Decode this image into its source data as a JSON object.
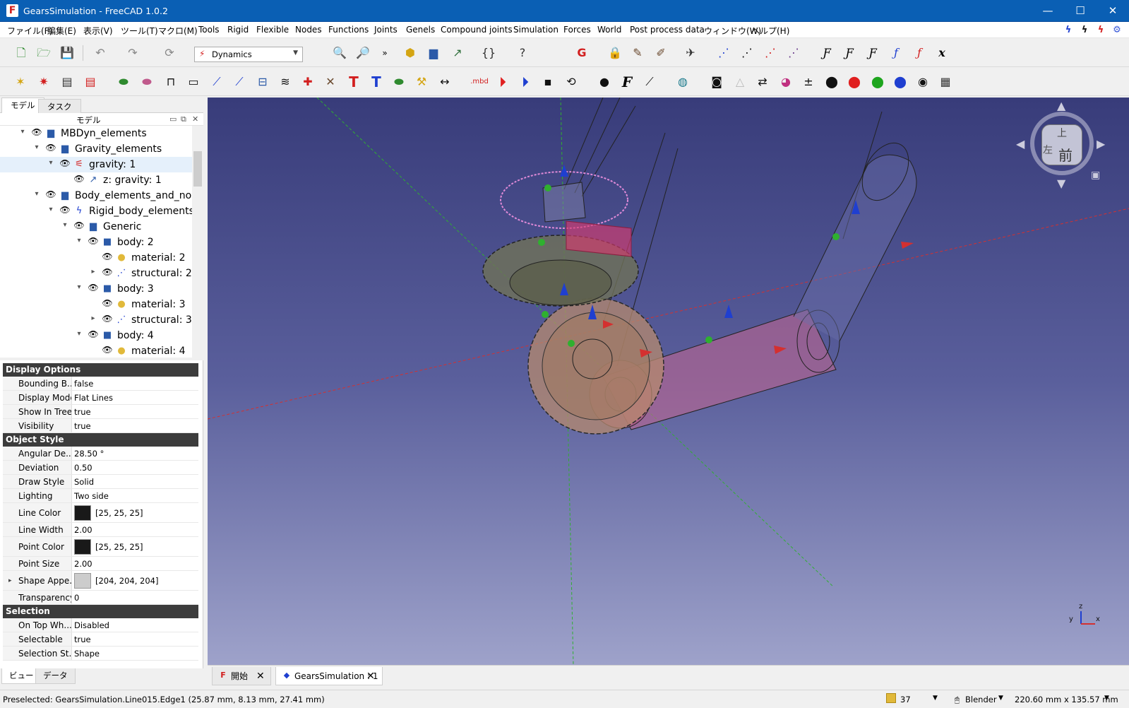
{
  "titlebar": {
    "title": "GearsSimulation - FreeCAD 1.0.2",
    "minimize": "—",
    "maximize": "☐",
    "close": "✕"
  },
  "menubar": {
    "items": [
      "ファイル(F)",
      "編集(E)",
      "表示(V)",
      "ツール(T)",
      "マクロ(M)",
      "Tools",
      "Rigid",
      "Flexible",
      "Nodes",
      "Functions",
      "Joints",
      "Genels",
      "Compound joints",
      "Simulation",
      "Forces",
      "World",
      "Post process data",
      "ウィンドウ(W)",
      "ヘルプ(H)"
    ]
  },
  "toolbar": {
    "workbench": "Dynamics",
    "more": "»",
    "mbd": ".mbd"
  },
  "tree": {
    "tabs": [
      "モデル",
      "タスク"
    ],
    "header": "モデル",
    "items": [
      {
        "label": "MBDyn_elements",
        "icon": "folder-icon"
      },
      {
        "label": "Gravity_elements",
        "icon": "folder-icon"
      },
      {
        "label": "gravity: 1",
        "icon": "gravity-icon"
      },
      {
        "label": "z: gravity: 1",
        "icon": "function-icon"
      },
      {
        "label": "Body_elements_and_no...",
        "icon": "folder-icon"
      },
      {
        "label": "Rigid_body_elements",
        "icon": "rigid-body-icon"
      },
      {
        "label": "Generic",
        "icon": "folder-icon"
      },
      {
        "label": "body: 2",
        "icon": "body-cube-icon"
      },
      {
        "label": "material: 2",
        "icon": "material-sphere-icon"
      },
      {
        "label": "structural: 2",
        "icon": "structural-node-icon"
      },
      {
        "label": "body: 3",
        "icon": "body-cube-icon"
      },
      {
        "label": "material: 3",
        "icon": "material-sphere-icon"
      },
      {
        "label": "structural: 3",
        "icon": "structural-node-icon"
      },
      {
        "label": "body: 4",
        "icon": "body-cube-icon"
      },
      {
        "label": "material: 4",
        "icon": "material-sphere-icon"
      }
    ]
  },
  "props": {
    "sections": [
      {
        "title": "Display Options",
        "rows": [
          {
            "name": "Bounding B...",
            "value": "false"
          },
          {
            "name": "Display Mode",
            "value": "Flat Lines"
          },
          {
            "name": "Show In Tree",
            "value": "true"
          },
          {
            "name": "Visibility",
            "value": "true"
          }
        ]
      },
      {
        "title": "Object Style",
        "rows": [
          {
            "name": "Angular De...",
            "value": "28.50 °"
          },
          {
            "name": "Deviation",
            "value": "0.50"
          },
          {
            "name": "Draw Style",
            "value": "Solid"
          },
          {
            "name": "Lighting",
            "value": "Two side"
          },
          {
            "name": "Line Color",
            "value": "[25, 25, 25]",
            "color": "#191919"
          },
          {
            "name": "Line Width",
            "value": "2.00"
          },
          {
            "name": "Point Color",
            "value": "[25, 25, 25]",
            "color": "#191919"
          },
          {
            "name": "Point Size",
            "value": "2.00"
          },
          {
            "name": "Shape Appe...",
            "value": "[204, 204, 204]",
            "color": "#cccccc"
          },
          {
            "name": "Transparency",
            "value": "0"
          }
        ]
      },
      {
        "title": "Selection",
        "rows": [
          {
            "name": "On Top Wh...",
            "value": "Disabled"
          },
          {
            "name": "Selectable",
            "value": "true"
          },
          {
            "name": "Selection St...",
            "value": "Shape"
          }
        ]
      }
    ],
    "bottom_tabs": [
      "ビュー",
      "データ"
    ]
  },
  "navcube": {
    "top": "上",
    "front": "前",
    "left": "左"
  },
  "axes": {
    "x": "x",
    "y": "y",
    "z": "z"
  },
  "doc_tabs": [
    {
      "label": "開始"
    },
    {
      "label": "GearsSimulation : 1"
    }
  ],
  "status": {
    "message": "Preselected: GearsSimulation.Line015.Edge1 (25.87 mm, 8.13 mm, 27.41 mm)",
    "count": "37",
    "navigation": "Blender",
    "dimensions": "220.60 mm x 135.57 mm"
  }
}
